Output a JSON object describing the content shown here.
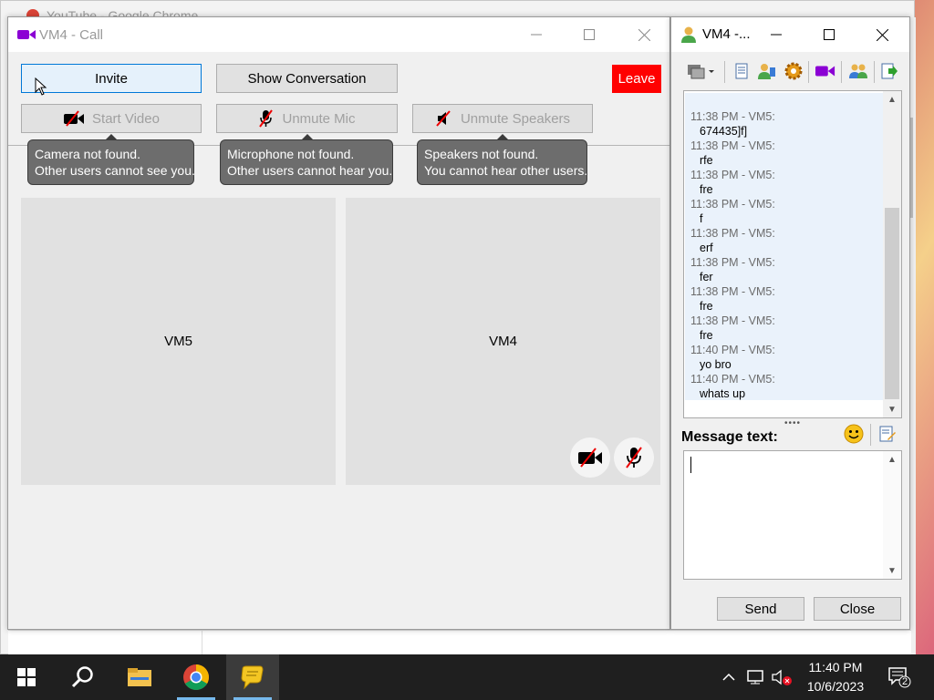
{
  "background": {
    "chrome_title": "YouTube - Google Chrome"
  },
  "call_window": {
    "title": "VM4 - Call",
    "buttons": {
      "invite": "Invite",
      "show_conversation": "Show Conversation",
      "leave": "Leave",
      "start_video": "Start Video",
      "unmute_mic": "Unmute Mic",
      "unmute_speakers": "Unmute Speakers"
    },
    "tooltips": {
      "camera_line1": "Camera not found.",
      "camera_line2": "Other users cannot see you.",
      "mic_line1": "Microphone not found.",
      "mic_line2": "Other users cannot hear you.",
      "speakers_line1": "Speakers not found.",
      "speakers_line2": "You cannot hear other users."
    },
    "tiles": {
      "left": "VM5",
      "right": "VM4"
    },
    "colors": {
      "leave": "#ff0000",
      "video_icon": "#8b00d4"
    }
  },
  "chat_window": {
    "title": "VM4 -...",
    "messages": [
      {
        "header": "11:38 PM - VM5:",
        "text": "674435]f]"
      },
      {
        "header": "11:38 PM - VM5:",
        "text": "rfe"
      },
      {
        "header": "11:38 PM - VM5:",
        "text": "fre"
      },
      {
        "header": "11:38 PM - VM5:",
        "text": "f"
      },
      {
        "header": "11:38 PM - VM5:",
        "text": "erf"
      },
      {
        "header": "11:38 PM - VM5:",
        "text": "fer"
      },
      {
        "header": "11:38 PM - VM5:",
        "text": "fre"
      },
      {
        "header": "11:38 PM - VM5:",
        "text": "fre"
      },
      {
        "header": "11:40 PM - VM5:",
        "text": "yo bro"
      },
      {
        "header": "11:40 PM - VM5:",
        "text": "whats up"
      }
    ],
    "message_label": "Message text:",
    "compose_value": "",
    "send": "Send",
    "close": "Close"
  },
  "taskbar": {
    "time": "11:40 PM",
    "date": "10/6/2023",
    "notification_count": "2"
  }
}
